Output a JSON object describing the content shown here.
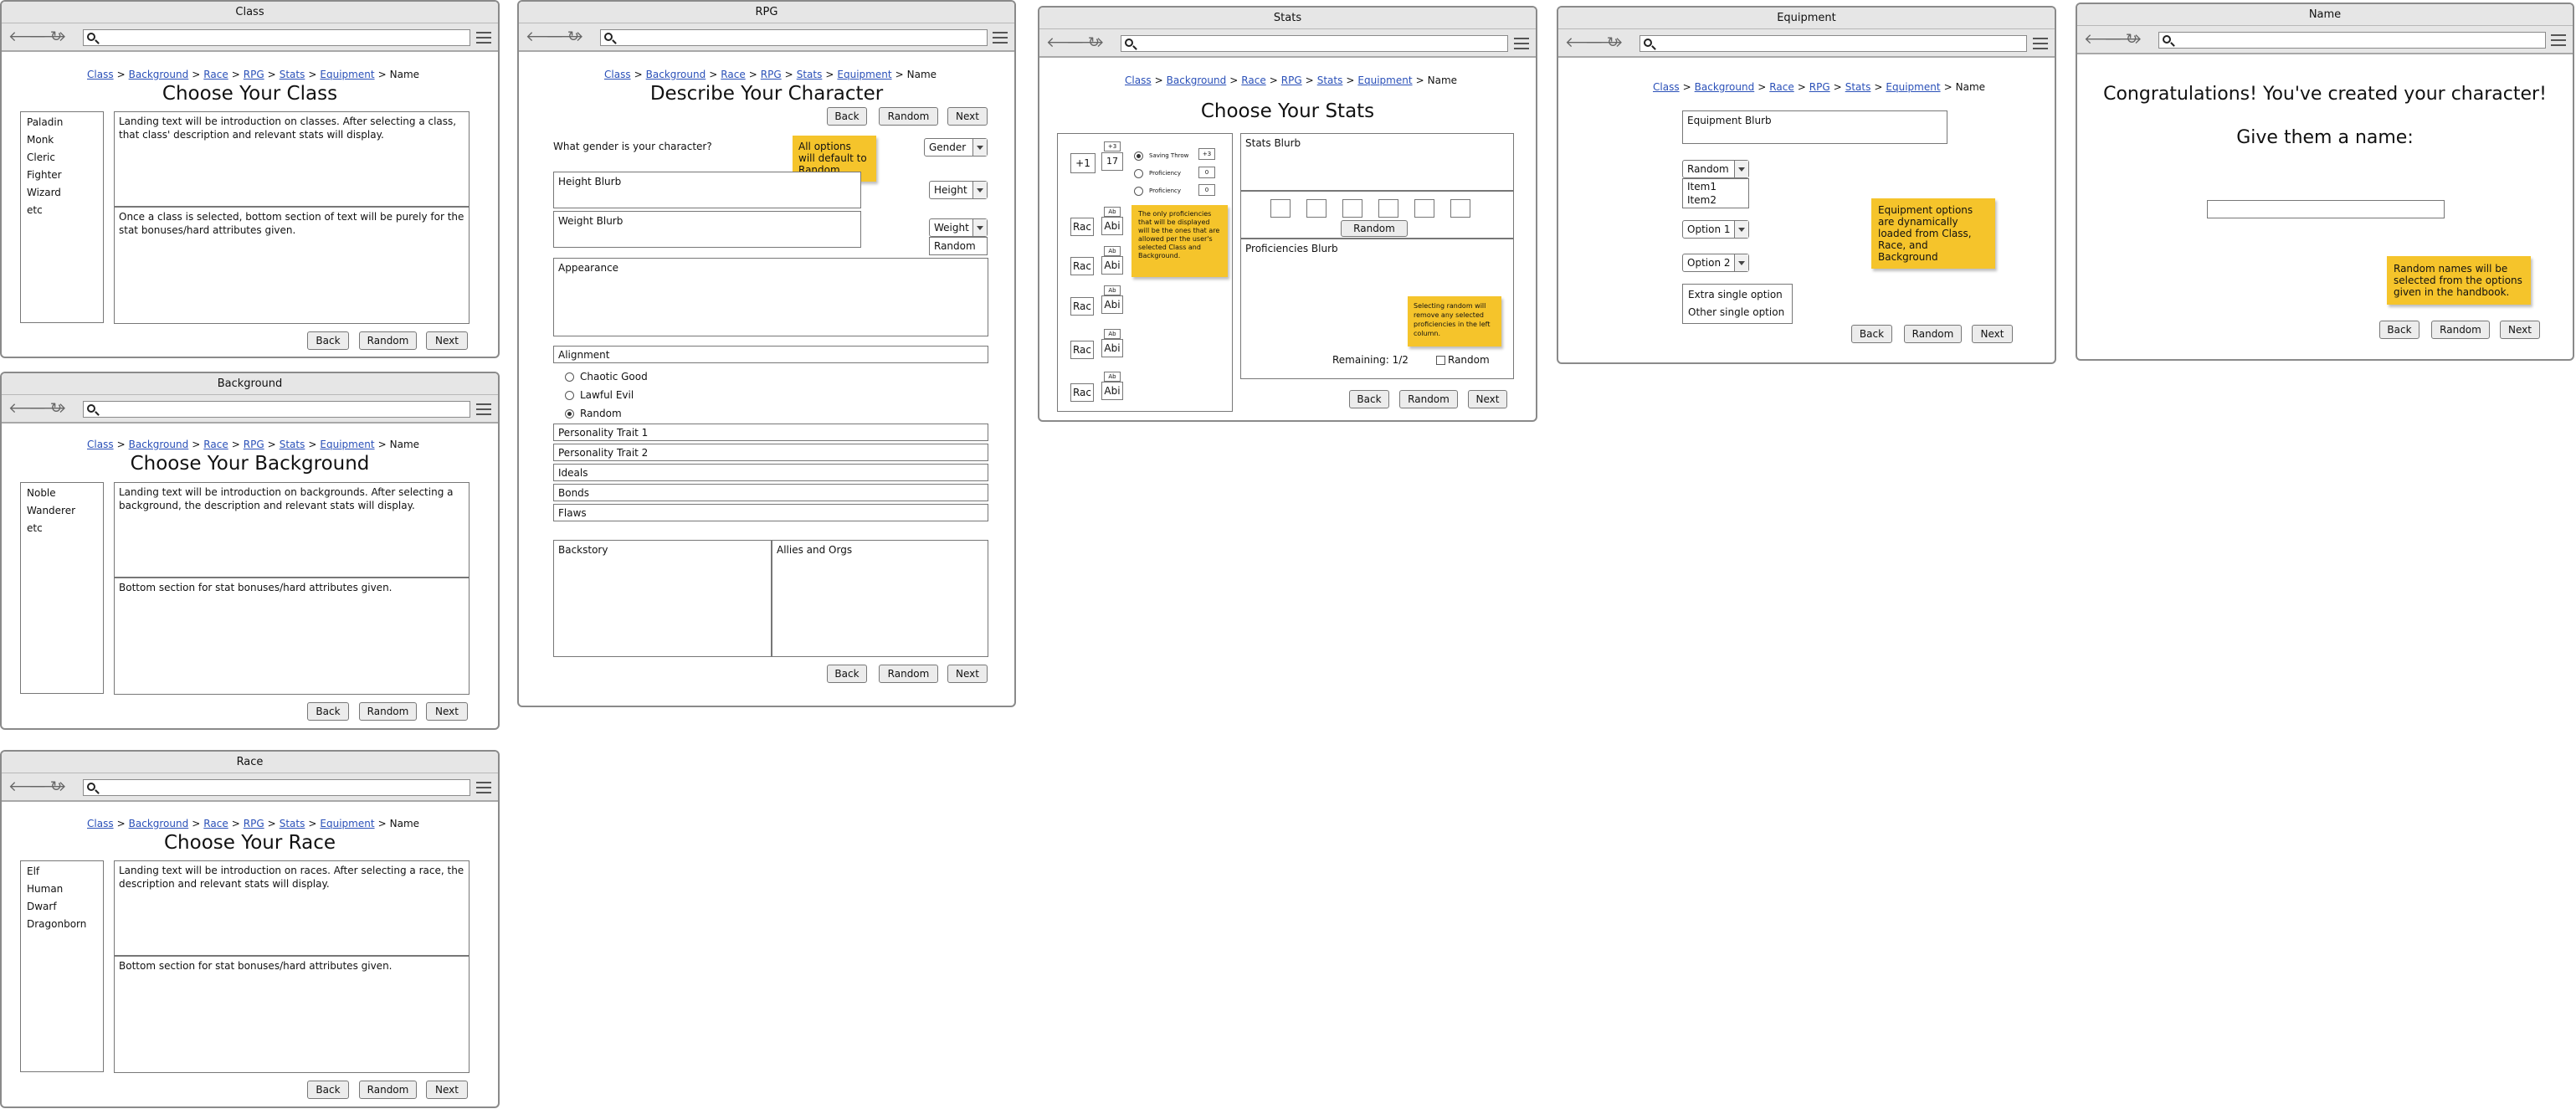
{
  "crumbs": [
    "Class",
    "Background",
    "Race",
    "RPG",
    "Stats",
    "Equipment"
  ],
  "crumb_current": "Name",
  "buttons": {
    "back": "Back",
    "random": "Random",
    "next": "Next"
  },
  "class_win": {
    "title": "Class",
    "heading": "Choose Your Class",
    "list": [
      "Paladin",
      "Monk",
      "Cleric",
      "Fighter",
      "Wizard",
      "etc"
    ],
    "top_text": "Landing text will be introduction on classes. After selecting a class, that class' description and relevant stats will display.",
    "bottom_text": "Once a class is selected, bottom section of text will be purely for the stat bonuses/hard attributes given."
  },
  "background_win": {
    "title": "Background",
    "heading": "Choose Your Background",
    "list": [
      "Noble",
      "Wanderer",
      "etc"
    ],
    "top_text": "Landing text will be introduction on backgrounds. After selecting a background, the description and relevant stats will display.",
    "bottom_text": "Bottom section for stat bonuses/hard attributes given."
  },
  "race_win": {
    "title": "Race",
    "heading": "Choose Your Race",
    "list": [
      "Elf",
      "Human",
      "Dwarf",
      "Dragonborn"
    ],
    "top_text": "Landing text will be introduction on races. After selecting a race, the description and relevant stats will display.",
    "bottom_text": "Bottom section for stat bonuses/hard attributes given."
  },
  "rpg_win": {
    "title": "RPG",
    "heading": "Describe Your Character",
    "gender_q": "What gender is your character?",
    "gender_sel": "Gender",
    "sticky": "All options will default to Random.",
    "height_blurb": "Height Blurb",
    "height_sel": "Height",
    "weight_blurb": "Weight Blurb",
    "weight_sel": "Weight",
    "weight_option": "Random",
    "appearance": "Appearance",
    "alignment": "Alignment",
    "alignment_options": [
      "Chaotic Good",
      "Lawful Evil",
      "Random"
    ],
    "fields": [
      "Personality Trait 1",
      "Personality Trait 2",
      "Ideals",
      "Bonds",
      "Flaws"
    ],
    "backstory": "Backstory",
    "allies": "Allies and Orgs"
  },
  "stats_win": {
    "title": "Stats",
    "heading": "Choose Your Stats",
    "bonus": "+1",
    "score_top": "+3",
    "score": "17",
    "radios": [
      "Saving Throw",
      "Proficiency",
      "Proficiency"
    ],
    "radio_vals": [
      "+3",
      "0",
      "0"
    ],
    "row_label": "Rac",
    "row_ab": "Abi",
    "row_tiny": "Ab",
    "sticky": "The only proficiencies that will be displayed will be the ones that are allowed per the user's selected Class and Background.",
    "stats_blurb": "Stats Blurb",
    "random_btn": "Random",
    "prof_blurb": "Proficiencies Blurb",
    "sticky2": "Selecting random will remove any selected proficiencies in the left column.",
    "remaining": "Remaining: 1/2",
    "random_check": "Random"
  },
  "equip_win": {
    "title": "Equipment",
    "blurb": "Equipment Blurb",
    "random_sel": "Random",
    "items": [
      "Item1",
      "Item2"
    ],
    "opt1": "Option 1",
    "opt2": "Option 2",
    "singles": [
      "Extra single option",
      "Other single option"
    ],
    "sticky": "Equipment options are dynamically loaded from Class, Race, and Background"
  },
  "name_win": {
    "title": "Name",
    "congrats": "Congratulations! You've created your character!",
    "prompt": "Give them a name:",
    "sticky": "Random names will be selected from the options given in the handbook."
  }
}
